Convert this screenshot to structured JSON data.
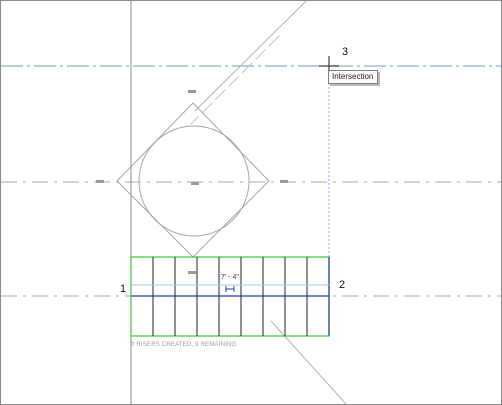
{
  "tooltip": {
    "text": "Intersection"
  },
  "callouts": {
    "point_1": "1",
    "point_2": "2",
    "point_3": "3"
  },
  "dimension": {
    "text": "7' - 4\""
  },
  "status": {
    "text": "0 RISERS CREATED, 9 REMAINING"
  },
  "colors": {
    "sketch_boundary": "#33cc33",
    "run_line": "#1f3a9e",
    "reference_plane": "#8fb0d0",
    "construction_line": "#a0a0a0",
    "riser": "#222222",
    "tooltip_border": "#7e7e7e"
  },
  "icons": {
    "cursor": "crosshair-cursor-icon",
    "grip": "grip-icon"
  }
}
